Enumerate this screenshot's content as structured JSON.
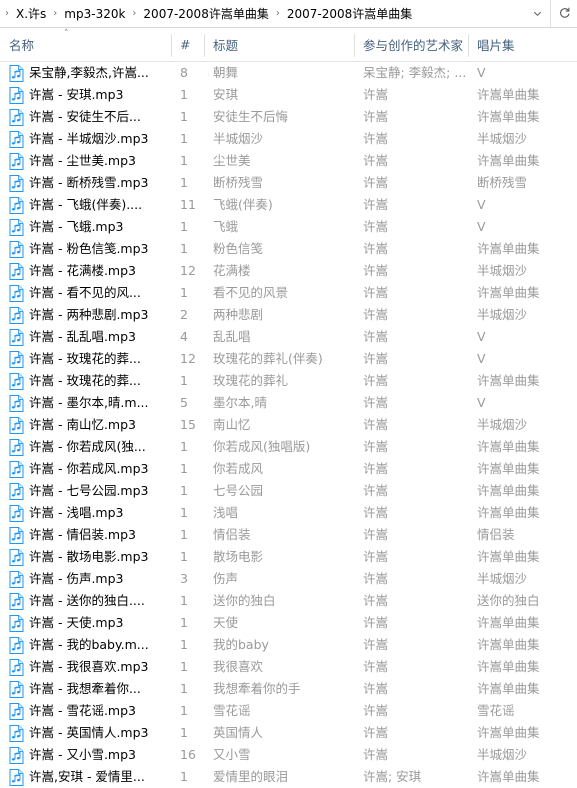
{
  "window": {
    "type": "file-explorer-list-view"
  },
  "addressbar": {
    "separator": "›",
    "crumbs": [
      "X.许s",
      "mp3-320k",
      "2007-2008许嵩单曲集",
      "2007-2008许嵩单曲集"
    ],
    "dropdown_icon": "chevron-down-icon",
    "refresh_icon": "refresh-icon"
  },
  "columns": {
    "name": "名称",
    "track": "#",
    "title": "标题",
    "artist": "参与创作的艺术家",
    "album": "唱片集",
    "sort_indicator": "˄"
  },
  "colors": {
    "header_text": "#45617f",
    "row_text": "#000000",
    "secondary_text": "#9a9a9a",
    "icon_accent": "#2196f3"
  },
  "rows": [
    {
      "name": "呆宝静,李毅杰,许嵩...",
      "track": "8",
      "title": "朝舞",
      "artist": "呆宝静; 李毅杰; ...",
      "album": "V"
    },
    {
      "name": "许嵩 - 安琪.mp3",
      "track": "1",
      "title": "安琪",
      "artist": "许嵩",
      "album": "许嵩单曲集"
    },
    {
      "name": "许嵩 - 安徒生不后...",
      "track": "1",
      "title": "安徒生不后悔",
      "artist": "许嵩",
      "album": "许嵩单曲集"
    },
    {
      "name": "许嵩 - 半城烟沙.mp3",
      "track": "1",
      "title": "半城烟沙",
      "artist": "许嵩",
      "album": "半城烟沙"
    },
    {
      "name": "许嵩 - 尘世美.mp3",
      "track": "1",
      "title": "尘世美",
      "artist": "许嵩",
      "album": "许嵩单曲集"
    },
    {
      "name": "许嵩 - 断桥残雪.mp3",
      "track": "1",
      "title": "断桥残雪",
      "artist": "许嵩",
      "album": "断桥残雪"
    },
    {
      "name": "许嵩 - 飞蛾(伴奏)....",
      "track": "11",
      "title": "飞蛾(伴奏)",
      "artist": "许嵩",
      "album": "V"
    },
    {
      "name": "许嵩 - 飞蛾.mp3",
      "track": "1",
      "title": "飞蛾",
      "artist": "许嵩",
      "album": "V"
    },
    {
      "name": "许嵩 - 粉色信笺.mp3",
      "track": "1",
      "title": "粉色信笺",
      "artist": "许嵩",
      "album": "许嵩单曲集"
    },
    {
      "name": "许嵩 - 花满楼.mp3",
      "track": "12",
      "title": "花满楼",
      "artist": "许嵩",
      "album": "半城烟沙"
    },
    {
      "name": "许嵩 - 看不见的风...",
      "track": "1",
      "title": "看不见的风景",
      "artist": "许嵩",
      "album": "许嵩单曲集"
    },
    {
      "name": "许嵩 - 两种悲剧.mp3",
      "track": "2",
      "title": "两种悲剧",
      "artist": "许嵩",
      "album": "半城烟沙"
    },
    {
      "name": "许嵩 - 乱乱唱.mp3",
      "track": "4",
      "title": "乱乱唱",
      "artist": "许嵩",
      "album": "V"
    },
    {
      "name": "许嵩 - 玫瑰花的葬...",
      "track": "12",
      "title": "玫瑰花的葬礼(伴奏)",
      "artist": "许嵩",
      "album": "V"
    },
    {
      "name": "许嵩 - 玫瑰花的葬...",
      "track": "1",
      "title": "玫瑰花的葬礼",
      "artist": "许嵩",
      "album": "许嵩单曲集"
    },
    {
      "name": "许嵩 - 墨尔本,晴.m...",
      "track": "5",
      "title": "墨尔本,晴",
      "artist": "许嵩",
      "album": "V"
    },
    {
      "name": "许嵩 - 南山忆.mp3",
      "track": "15",
      "title": "南山忆",
      "artist": "许嵩",
      "album": "半城烟沙"
    },
    {
      "name": "许嵩 - 你若成风(独...",
      "track": "1",
      "title": "你若成风(独唱版)",
      "artist": "许嵩",
      "album": "许嵩单曲集"
    },
    {
      "name": "许嵩 - 你若成风.mp3",
      "track": "1",
      "title": "你若成风",
      "artist": "许嵩",
      "album": "许嵩单曲集"
    },
    {
      "name": "许嵩 - 七号公园.mp3",
      "track": "1",
      "title": "七号公园",
      "artist": "许嵩",
      "album": "许嵩单曲集"
    },
    {
      "name": "许嵩 - 浅唱.mp3",
      "track": "1",
      "title": "浅唱",
      "artist": "许嵩",
      "album": "许嵩单曲集"
    },
    {
      "name": "许嵩 - 情侣装.mp3",
      "track": "1",
      "title": "情侣装",
      "artist": "许嵩",
      "album": "情侣装"
    },
    {
      "name": "许嵩 - 散场电影.mp3",
      "track": "1",
      "title": "散场电影",
      "artist": "许嵩",
      "album": "许嵩单曲集"
    },
    {
      "name": "许嵩 - 伤声.mp3",
      "track": "3",
      "title": "伤声",
      "artist": "许嵩",
      "album": "半城烟沙"
    },
    {
      "name": "许嵩 - 送你的独白....",
      "track": "1",
      "title": "送你的独白",
      "artist": "许嵩",
      "album": "送你的独白"
    },
    {
      "name": "许嵩 - 天使.mp3",
      "track": "1",
      "title": "天使",
      "artist": "许嵩",
      "album": "许嵩单曲集"
    },
    {
      "name": "许嵩 - 我的baby.m...",
      "track": "1",
      "title": "我的baby",
      "artist": "许嵩",
      "album": "许嵩单曲集"
    },
    {
      "name": "许嵩 - 我很喜欢.mp3",
      "track": "1",
      "title": "我很喜欢",
      "artist": "许嵩",
      "album": "许嵩单曲集"
    },
    {
      "name": "许嵩 - 我想牽着你...",
      "track": "1",
      "title": "我想牽着你的手",
      "artist": "许嵩",
      "album": "许嵩单曲集"
    },
    {
      "name": "许嵩 - 雪花谣.mp3",
      "track": "1",
      "title": "雪花谣",
      "artist": "许嵩",
      "album": "雪花谣"
    },
    {
      "name": "许嵩 - 英国情人.mp3",
      "track": "1",
      "title": "英国情人",
      "artist": "许嵩",
      "album": "许嵩单曲集"
    },
    {
      "name": "许嵩 - 又小雪.mp3",
      "track": "16",
      "title": "又小雪",
      "artist": "许嵩",
      "album": "半城烟沙"
    },
    {
      "name": "许嵩,安琪 - 爱情里...",
      "track": "1",
      "title": "爱情里的眼泪",
      "artist": "许嵩; 安琪",
      "album": "许嵩单曲集"
    }
  ]
}
